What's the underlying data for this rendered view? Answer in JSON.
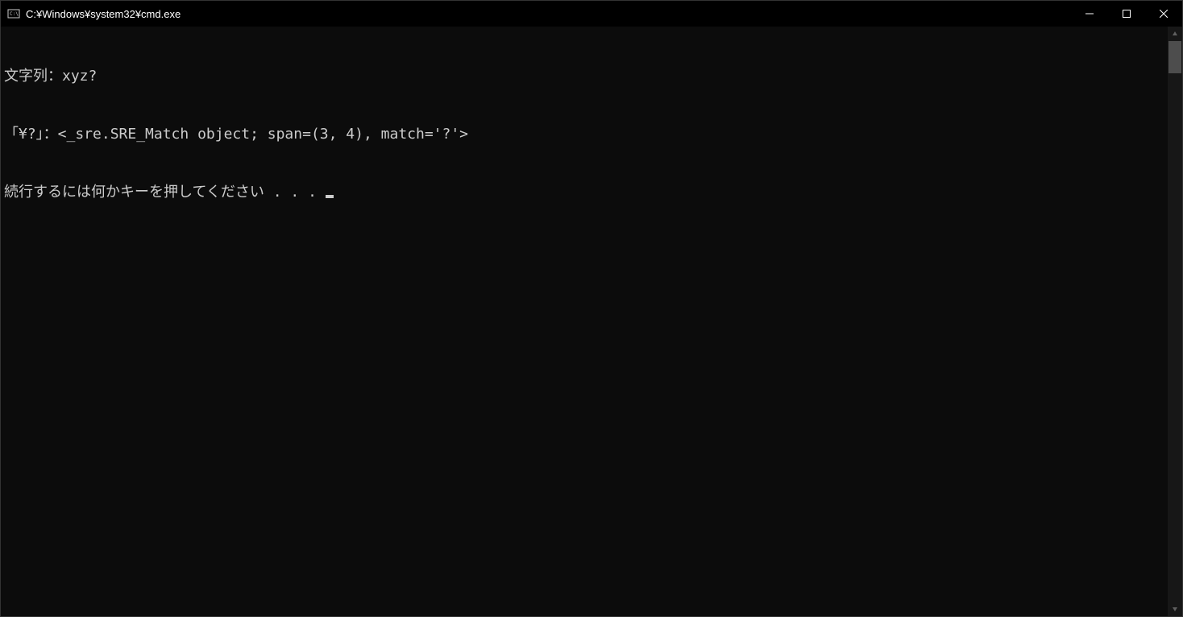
{
  "titlebar": {
    "title": "C:¥Windows¥system32¥cmd.exe"
  },
  "terminal": {
    "lines": [
      "文字列：xyz?",
      "「¥?」：<_sre.SRE_Match object; span=(3, 4), match='?'>",
      "続行するには何かキーを押してください . . . "
    ]
  }
}
